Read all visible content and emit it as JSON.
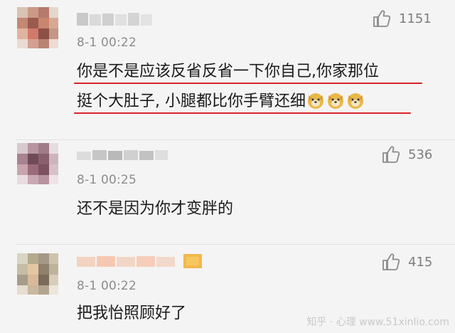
{
  "comments": [
    {
      "time": "8-1 00:22",
      "likes": "1151",
      "text_lines": [
        "你是不是应该反省反省一下你自己,你家那位",
        "挺个大肚子, 小腿都比你手臂还细"
      ],
      "emoji": [
        "doge-emoji",
        "doge-emoji",
        "doge-emoji"
      ],
      "highlight_color": "#d8222a"
    },
    {
      "time": "8-1 00:25",
      "likes": "536",
      "text_lines": [
        "还不是因为你才变胖的"
      ]
    },
    {
      "time": "8-1 00:22",
      "likes": "415",
      "text_lines": [
        "把我怡照顾好了"
      ]
    }
  ],
  "watermark": "知乎 · 心理 www.51xinlio.com",
  "colors": {
    "background": "#f4f4f4",
    "underline": "#d8222a",
    "meta_text": "#8c8c8c"
  }
}
